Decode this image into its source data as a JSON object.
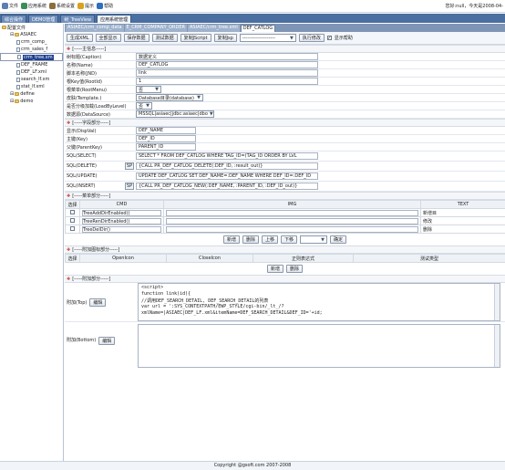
{
  "menubar": {
    "items": [
      {
        "label": "文件",
        "icon": "file-icon",
        "color": "#5a7fb0"
      },
      {
        "label": "应用系统",
        "icon": "app-icon",
        "color": "#3c8d5a"
      },
      {
        "label": "系统设置",
        "icon": "settings-icon",
        "color": "#8a6f3c"
      },
      {
        "label": "提示",
        "icon": "tip-icon",
        "color": "#d8a21e"
      },
      {
        "label": "帮助",
        "icon": "help-icon",
        "color": "#2f6fc0"
      }
    ],
    "user_info": "您好:null，今天是2008-04-"
  },
  "nav_tabs": [
    "综合操作",
    "DEMO管理",
    "树_TreeView",
    "应用系统管理"
  ],
  "sidebar": {
    "root": "配置文件",
    "items": [
      {
        "label": "ASIAEC",
        "level": 1,
        "type": "folder"
      },
      {
        "label": "crm_comp_",
        "level": 2,
        "type": "doc"
      },
      {
        "label": "crm_sales_f",
        "level": 2,
        "type": "doc"
      },
      {
        "label": "crm_tree.xm",
        "level": 2,
        "type": "doc",
        "selected": true
      },
      {
        "label": "DEF_FRAME",
        "level": 2,
        "type": "doc"
      },
      {
        "label": "DEF_LF.xml",
        "level": 2,
        "type": "doc"
      },
      {
        "label": "search_lf.xm",
        "level": 2,
        "type": "doc"
      },
      {
        "label": "stat_lf.xml",
        "level": 2,
        "type": "doc"
      },
      {
        "label": "define",
        "level": 1,
        "type": "folder"
      },
      {
        "label": "demo",
        "level": 1,
        "type": "folder"
      }
    ]
  },
  "content_tabs": [
    "ASIAEC/crm_comp_data",
    "E_CRM_COMPANY_ORDER",
    "ASIAEC/crm_tree.xml",
    "DEF_CATLOG"
  ],
  "toolbar": {
    "buttons": [
      "生成XML",
      "全部显示",
      "保存数据",
      "测试数据",
      "复制JScript",
      "复制Jsp"
    ],
    "select_value": "--------------------",
    "run_button": "执行修改",
    "show_help_label": "显示帮助",
    "show_help_checked": true
  },
  "section_main": {
    "title": "[-----主信息-----]"
  },
  "main_fields": [
    {
      "label": "树标题(Caption)",
      "value": "数据定义",
      "type": "input",
      "width": 200
    },
    {
      "label": "名称(Name)",
      "value": "DEF_CATLOG",
      "type": "input",
      "width": 200
    },
    {
      "label": "脚本名称(JND)",
      "value": "link",
      "type": "input",
      "width": 200
    },
    {
      "label": "根Key值(RootId)",
      "value": "1",
      "type": "input",
      "width": 200
    },
    {
      "label": "根菜单(RootMenu)",
      "value": "否",
      "type": "select",
      "width": 28
    },
    {
      "label": "皮肤(Template.)",
      "value": "Database目录(database)",
      "type": "select",
      "width": 74
    },
    {
      "label": "是否分级加载(LoadByLevel)",
      "value": "否",
      "type": "select",
      "width": 18
    },
    {
      "label": "数据源(DataSource)",
      "value": "MSSQL|asiaec|jdbc:asiaec|dbo",
      "type": "select",
      "width": 86
    }
  ],
  "section_field": {
    "title": "[-----字段部分-----]"
  },
  "field_fields": [
    {
      "label": "显示(DispVal)",
      "value": "DEF_NAME",
      "sp": false,
      "width": 66
    },
    {
      "label": "主键(Key)",
      "value": "DEF_ID",
      "sp": false,
      "width": 66
    },
    {
      "label": "父键(ParentKey)",
      "value": "PARENT_ID",
      "sp": false,
      "width": 66
    },
    {
      "label": "SQL(SELECT)",
      "value": "SELECT * FROM DEF_CATLOG WHERE TAG_ID=(TAG_ID ORDER BY LVL",
      "sp": false,
      "width": 200
    },
    {
      "label": "SQL(DELETE)",
      "value": "{CALL PR_DEF_CATLOG_DELETE(:DEF_ID, :result_out)}",
      "sp": true,
      "width": 200
    },
    {
      "label": "SQL(UPDATE)",
      "value": "UPDATE DEF_CATLOG SET DEF_NAME=:DEF_NAME WHERE DEF_ID=:DEF_ID",
      "sp": false,
      "width": 200
    },
    {
      "label": "SQL(INSERT)",
      "value": "{CALL PR_DEF_CATLOG_NEW(:DEF_NAME, :PARENT_ID, :DEF_ID_out)}",
      "sp": true,
      "width": 200
    }
  ],
  "section_menu": {
    "title": "[-----菜单部分-----]"
  },
  "menu_table": {
    "headers": [
      "选择",
      "CMD",
      "IMG",
      "TEXT"
    ],
    "rows": [
      {
        "cmd": "TreeAddDirEnabled()",
        "text": "新增目"
      },
      {
        "cmd": "TreeRenDirEnabled()",
        "text": "修改"
      },
      {
        "cmd": "TreeDelDir()",
        "text": "删除"
      }
    ],
    "buttons": [
      "新增",
      "删除",
      "上移",
      "下移"
    ],
    "select_value": "",
    "ok_button": "确定"
  },
  "section_icon": {
    "title": "[-----附加图标部分-----]"
  },
  "icon_table": {
    "headers": [
      "选择",
      "OpenIcon",
      "CloseIcon",
      "正则表达式",
      "测试类型"
    ],
    "buttons": [
      "新增",
      "删除"
    ]
  },
  "section_attach": {
    "title": "[-----附加部分-----]"
  },
  "attach": {
    "top_label": "附加(Top)",
    "bottom_label": "附加(Bottom)",
    "edit_label": "编辑",
    "top_code": [
      "<script>",
      "function link(id){",
      "        //调用DEF_SEARCH_DETAIL, DEF_SEARCH_DETAIL的列表",
      "        var url = ':SYS_CONTEXTPATH/EWP_STYLE/cgi-bin/_lt_/?",
      "xmlName=|ASIAEC|DEF_LF.xml&itemName=DEF_SEARCH_DETAIL&DEF_ID='+id;"
    ],
    "bottom_code": []
  },
  "footer": "Copyright @gsoft.com 2007-2008"
}
